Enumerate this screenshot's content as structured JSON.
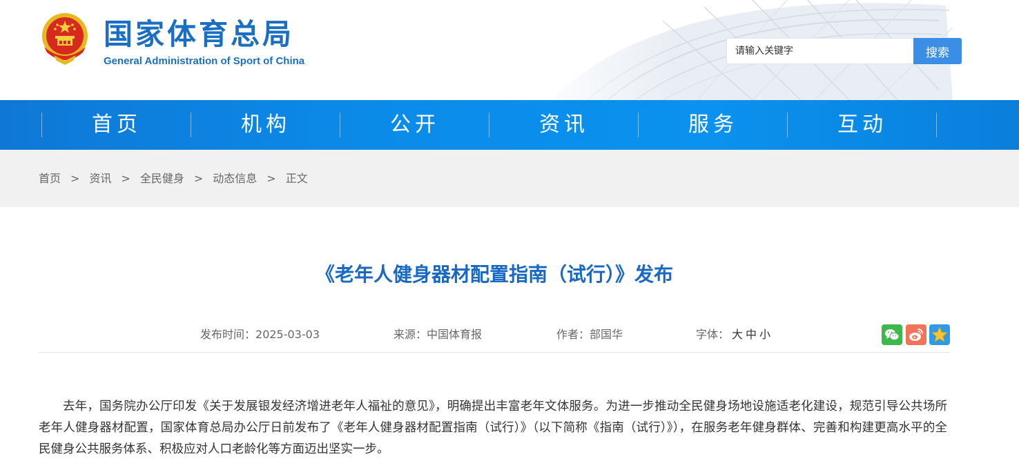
{
  "header": {
    "site_title_cn": "国家体育总局",
    "site_title_en": "General Administration of Sport of China",
    "emblem": "national-emblem",
    "search": {
      "placeholder": "请输入关键字",
      "button_label": "搜索"
    }
  },
  "nav": {
    "items": [
      {
        "label": "首页"
      },
      {
        "label": "机构"
      },
      {
        "label": "公开"
      },
      {
        "label": "资讯"
      },
      {
        "label": "服务"
      },
      {
        "label": "互动"
      }
    ]
  },
  "breadcrumb": {
    "items": [
      "首页",
      "资讯",
      "全民健身",
      "动态信息",
      "正文"
    ],
    "separator": ">"
  },
  "article": {
    "title": "《老年人健身器材配置指南（试行）》发布",
    "meta": {
      "date_label": "发布时间：",
      "date": "2025-03-03",
      "source_label": "来源：",
      "source": "中国体育报",
      "author_label": "作者：",
      "author": "部国华",
      "font_label": "字体：",
      "font_large": "大",
      "font_medium": "中",
      "font_small": "小"
    },
    "share_icons": [
      "wechat-icon",
      "weibo-icon",
      "favorite-icon"
    ],
    "body": "去年，国务院办公厅印发《关于发展银发经济增进老年人福祉的意见》，明确提出丰富老年文体服务。为进一步推动全民健身场地设施适老化建设，规范引导公共场所老年人健身器材配置，国家体育总局办公厅日前发布了《老年人健身器材配置指南（试行）》（以下简称《指南（试行）》），在服务老年健身群体、完善和构建更高水平的全民健身公共服务体系、积极应对人口老龄化等方面迈出坚实一步。"
  },
  "colors": {
    "brand_blue": "#1b6fc2",
    "nav_blue": "#0b8cea",
    "title_blue": "#1769c4",
    "search_button": "#3b8ee6",
    "wechat_green": "#3db94b",
    "weibo_red": "#f0735a",
    "favorite_blue": "#2f9be8"
  }
}
